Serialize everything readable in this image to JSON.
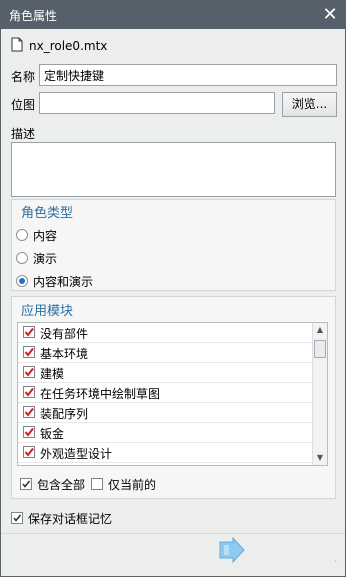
{
  "window": {
    "title": "角色属性"
  },
  "file": {
    "name": "nx_role0.mtx"
  },
  "name_field": {
    "label": "名称",
    "value": "定制快捷键"
  },
  "bitmap_field": {
    "label": "位图",
    "value": "",
    "browse_label": "浏览..."
  },
  "description": {
    "label": "描述",
    "value": ""
  },
  "role_type": {
    "title": "角色类型",
    "options": [
      {
        "label": "内容",
        "selected": false
      },
      {
        "label": "演示",
        "selected": false
      },
      {
        "label": "内容和演示",
        "selected": true
      }
    ]
  },
  "modules": {
    "title": "应用模块",
    "items": [
      {
        "label": "没有部件",
        "checked": true
      },
      {
        "label": "基本环境",
        "checked": true
      },
      {
        "label": "建模",
        "checked": true
      },
      {
        "label": "在任务环境中绘制草图",
        "checked": true
      },
      {
        "label": "装配序列",
        "checked": true
      },
      {
        "label": "钣金",
        "checked": true
      },
      {
        "label": "外观造型设计",
        "checked": true
      }
    ],
    "include_all": {
      "label": "包含全部",
      "checked": true
    },
    "current_only": {
      "label": "仅当前的",
      "checked": false
    }
  },
  "save_dialog_memory": {
    "label": "保存对话框记忆",
    "checked": true
  },
  "colors": {
    "titlebar": "#55606b",
    "accent": "#2d6fa3",
    "check_red": "#cc1f1f"
  }
}
